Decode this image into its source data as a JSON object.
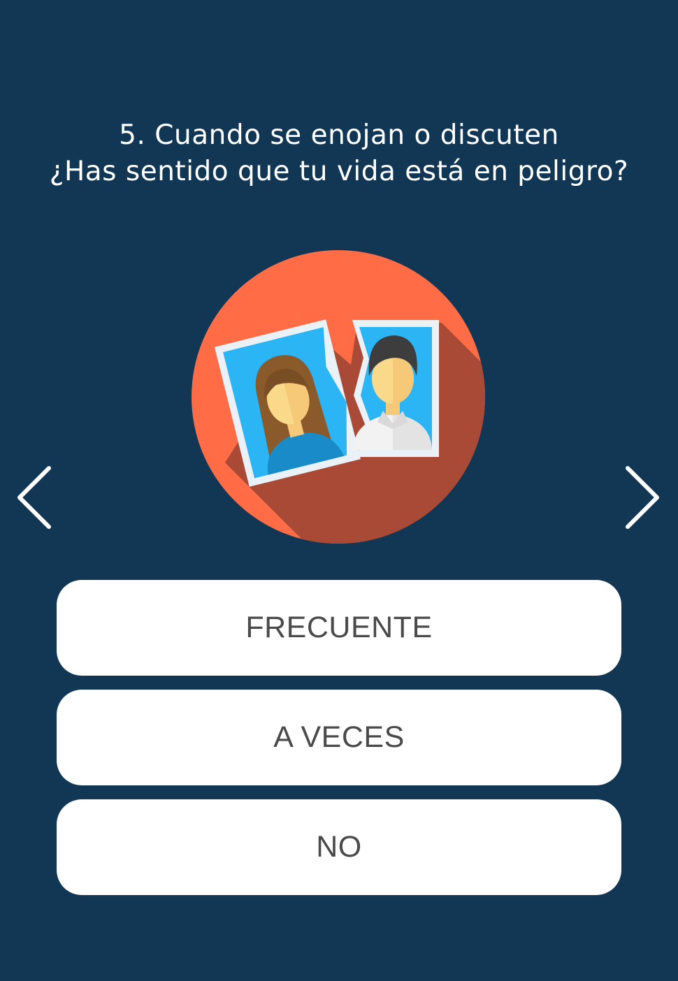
{
  "question": {
    "line1": "5. Cuando se enojan o discuten",
    "line2": "¿Has sentido que tu vida está en peligro?"
  },
  "illustration": {
    "icon": "torn-couple-photo-icon",
    "circle_color": "#FF6C45",
    "shadow_color": "#A84A36",
    "photo_background": "#2CB5F5"
  },
  "navigation": {
    "prev_icon": "chevron-left-icon",
    "next_icon": "chevron-right-icon"
  },
  "answers": [
    {
      "label": "FRECUENTE"
    },
    {
      "label": "A VECES"
    },
    {
      "label": "NO"
    }
  ],
  "colors": {
    "background": "#113754",
    "button_background": "#FFFFFF",
    "button_text": "#4A4A4A",
    "question_text": "#FFFFFF"
  }
}
